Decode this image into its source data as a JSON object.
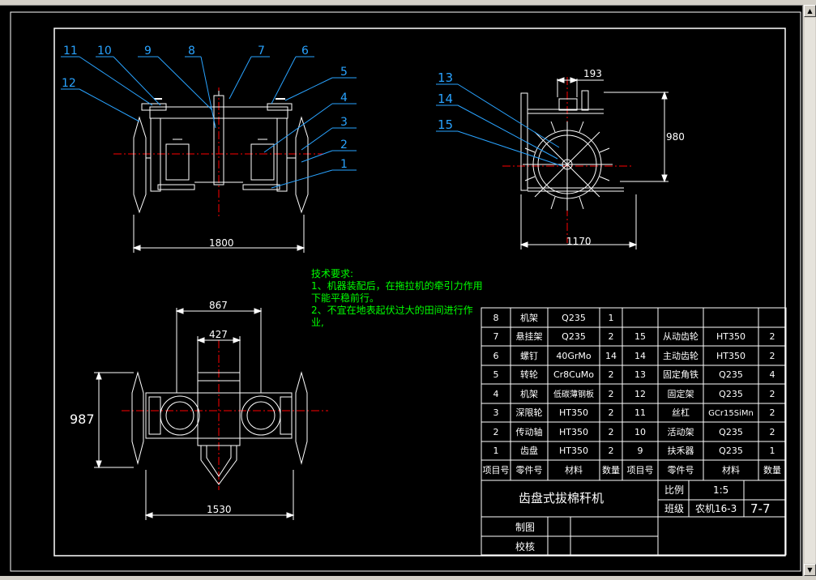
{
  "drawing": {
    "part_numbers_front": [
      "11",
      "10",
      "9",
      "8",
      "7",
      "6",
      "5",
      "4",
      "3",
      "2",
      "1",
      "12"
    ],
    "part_numbers_side": [
      "13",
      "14",
      "15"
    ],
    "dims": {
      "front_width": "1800",
      "side_top": "193",
      "side_height": "980",
      "side_width": "1170",
      "plan_outer": "867",
      "plan_inner": "427",
      "plan_height": "987",
      "plan_width": "1530"
    }
  },
  "tech_notes": {
    "title": "技术要求:",
    "line1": "1、机器装配后，在拖拉机的牵引力作用",
    "line2": "下能平稳前行。",
    "line3": "2、不宜在地表起伏过大的田间进行作",
    "line4": "业,"
  },
  "bom": {
    "rows": [
      [
        "8",
        "机架",
        "Q235",
        "1",
        "",
        "",
        "",
        ""
      ],
      [
        "7",
        "悬挂架",
        "Q235",
        "2",
        "15",
        "从动齿轮",
        "HT350",
        "2"
      ],
      [
        "6",
        "螺钉",
        "40GrMo",
        "14",
        "14",
        "主动齿轮",
        "HT350",
        "2"
      ],
      [
        "5",
        "转轮",
        "Cr8CuMo",
        "2",
        "13",
        "固定角铁",
        "Q235",
        "4"
      ],
      [
        "4",
        "机架",
        "低碳薄钢板",
        "2",
        "12",
        "固定架",
        "Q235",
        "2"
      ],
      [
        "3",
        "深限轮",
        "HT350",
        "2",
        "11",
        "丝杠",
        "GCr15SiMn",
        "2"
      ],
      [
        "2",
        "传动轴",
        "HT350",
        "2",
        "10",
        "活动架",
        "Q235",
        "2"
      ],
      [
        "1",
        "齿盘",
        "HT350",
        "2",
        "9",
        "扶禾器",
        "Q235",
        "1"
      ]
    ],
    "header": [
      "项目号",
      "零件号",
      "材料",
      "数量",
      "项目号",
      "零件号",
      "材料",
      "数量"
    ]
  },
  "title_block": {
    "name": "齿盘式拔棉秆机",
    "scale_label": "比例",
    "scale_value": "1:5",
    "class_label": "班级",
    "class_value": "农机16-3",
    "sheet_no": "7-7",
    "drawn_label": "制图",
    "checked_label": "校核"
  },
  "colors": {
    "background": "#000000",
    "frame": "#ffffff",
    "leader": "#29a3ff",
    "centerline": "#ff0000",
    "notes": "#00ff00",
    "parts": "#ffffff"
  }
}
